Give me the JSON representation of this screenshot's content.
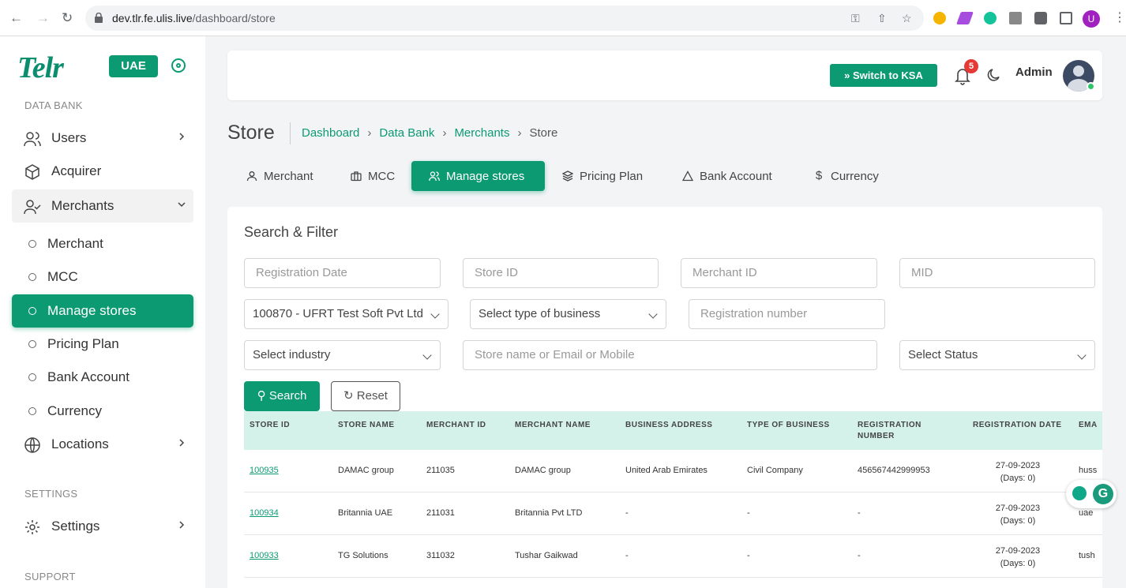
{
  "browser": {
    "url_host": "dev.tlr.fe.ulis.live",
    "url_path": "/dashboard/store",
    "profile_initial": "U"
  },
  "sidebar": {
    "logo": "Telr",
    "region_badge": "UAE",
    "section_data_bank": "DATA BANK",
    "items": [
      {
        "label": "Users",
        "icon": "users-icon"
      },
      {
        "label": "Acquirer",
        "icon": "cube-icon"
      },
      {
        "label": "Merchants",
        "icon": "user-check-icon"
      }
    ],
    "sub_items": [
      {
        "label": "Merchant"
      },
      {
        "label": "MCC"
      },
      {
        "label": "Manage stores",
        "active": true
      },
      {
        "label": "Pricing Plan"
      },
      {
        "label": "Bank Account"
      },
      {
        "label": "Currency"
      }
    ],
    "locations": "Locations",
    "section_settings": "SETTINGS",
    "settings": "Settings",
    "section_support": "SUPPORT"
  },
  "header": {
    "switch_label": "» Switch to KSA",
    "notifications_count": "5",
    "admin_label": "Admin"
  },
  "page": {
    "title": "Store",
    "breadcrumb": [
      "Dashboard",
      "Data Bank",
      "Merchants",
      "Store"
    ]
  },
  "tabs": [
    {
      "label": "Merchant",
      "icon": "user-icon"
    },
    {
      "label": "MCC",
      "icon": "briefcase-icon"
    },
    {
      "label": "Manage stores",
      "icon": "users-icon",
      "active": true
    },
    {
      "label": "Pricing Plan",
      "icon": "layers-icon"
    },
    {
      "label": "Bank Account",
      "icon": "triangle-icon"
    },
    {
      "label": "Currency",
      "icon": "dollar-icon"
    }
  ],
  "filter": {
    "title": "Search & Filter",
    "registration_date_placeholder": "Registration Date",
    "store_id_placeholder": "Store ID",
    "merchant_id_placeholder": "Merchant ID",
    "mid_placeholder": "MID",
    "merchant_select_value": "100870 - UFRT Test Soft Pvt Ltd",
    "business_type_placeholder": "Select type of business",
    "registration_number_placeholder": "Registration number",
    "industry_placeholder": "Select industry",
    "store_search_placeholder": "Store name or Email or Mobile",
    "status_placeholder": "Select Status",
    "search_label": "Search",
    "reset_label": "Reset"
  },
  "table": {
    "headers": [
      "STORE ID",
      "STORE NAME",
      "MERCHANT ID",
      "MERCHANT NAME",
      "BUSINESS ADDRESS",
      "TYPE OF BUSINESS",
      "REGISTRATION\nNUMBER",
      "REGISTRATION DATE",
      "EMA"
    ],
    "rows": [
      {
        "store_id": "100935",
        "store_name": "DAMAC group",
        "merchant_id": "211035",
        "merchant_name": "DAMAC group",
        "address": "United Arab Emirates",
        "business_type": "Civil Company",
        "reg_number": "456567442999953",
        "reg_date": "27-09-2023",
        "days": "(Days: 0)",
        "email": "huss"
      },
      {
        "store_id": "100934",
        "store_name": "Britannia UAE",
        "merchant_id": "211031",
        "merchant_name": "Britannia Pvt LTD",
        "address": "-",
        "business_type": "-",
        "reg_number": "-",
        "reg_date": "27-09-2023",
        "days": "(Days: 0)",
        "email": "uae"
      },
      {
        "store_id": "100933",
        "store_name": "TG Solutions",
        "merchant_id": "311032",
        "merchant_name": "Tushar Gaikwad",
        "address": "-",
        "business_type": "-",
        "reg_number": "-",
        "reg_date": "27-09-2023",
        "days": "(Days: 0)",
        "email": "tush"
      }
    ]
  },
  "colors": {
    "brand": "#0c9a72",
    "table_header_bg": "#d5f2ea",
    "badge_red": "#e53935"
  }
}
